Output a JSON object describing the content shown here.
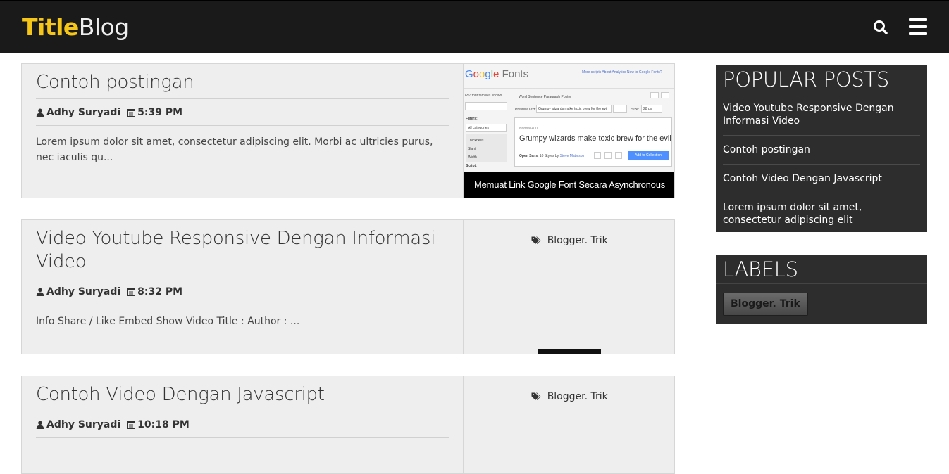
{
  "header": {
    "logo_part1": "Title",
    "logo_part2": "Blog",
    "search_icon": "search-icon",
    "menu_icon": "hamburger-menu-icon"
  },
  "posts": [
    {
      "title": "Contoh postingan",
      "author": "Adhy Suryadi",
      "time": "5:39 PM",
      "snippet": "Lorem ipsum dolor sit amet, consectetur adipiscing elit. Morbi ac ultricies purus, nec iaculis qu...",
      "thumbnail": {
        "caption": "Memuat Link Google Font Secara Asynchronous",
        "logo_fonts": "Fonts",
        "nav_links": "More scripts   About   Analytics   New to Google Fonts?",
        "count": "657 font families shown",
        "tabs": "Word   Sentence   Paragraph   Poster",
        "preview_text_label": "Preview Text:",
        "preview_text": "Grumpy wizards make toxic brew for the evil",
        "size_label": "Size:",
        "size_value": "28 px",
        "filters_label": "Filters:",
        "filter_value": "All categories",
        "filter_items": [
          "Thickness",
          "Slant",
          "Width"
        ],
        "script_label": "Script:",
        "font_label": "Normal 400",
        "sample": "Grumpy wizards make toxic brew for the evil Q",
        "font_name": "Open Sans",
        "font_styles": ", 10 Styles by ",
        "font_author": "Steve Matteson",
        "add_button": "Add to Collection"
      }
    },
    {
      "title": "Video Youtube Responsive Dengan Informasi Video",
      "author": "Adhy Suryadi",
      "time": "8:32 PM",
      "snippet": "Info Share / Like Embed Show Video Title : Author : ...",
      "label": "Blogger. Trik"
    },
    {
      "title": "Contoh Video Dengan Javascript",
      "author": "Adhy Suryadi",
      "time": "10:18 PM",
      "snippet": "",
      "label": "Blogger. Trik"
    }
  ],
  "sidebar": {
    "popular_title": "POPULAR POSTS",
    "popular_posts": [
      "Video Youtube Responsive Dengan Informasi Video",
      "Contoh postingan",
      "Contoh Video Dengan Javascript",
      "Lorem ipsum dolor sit amet, consectetur adipiscing elit"
    ],
    "labels_title": "LABELS",
    "labels": [
      "Blogger. Trik"
    ]
  },
  "colors": {
    "header_bg": "#1a1a1a",
    "logo_accent": "#f5c518",
    "card_bg": "#eeeeee",
    "sidebar_bg": "#2d2d2d"
  }
}
